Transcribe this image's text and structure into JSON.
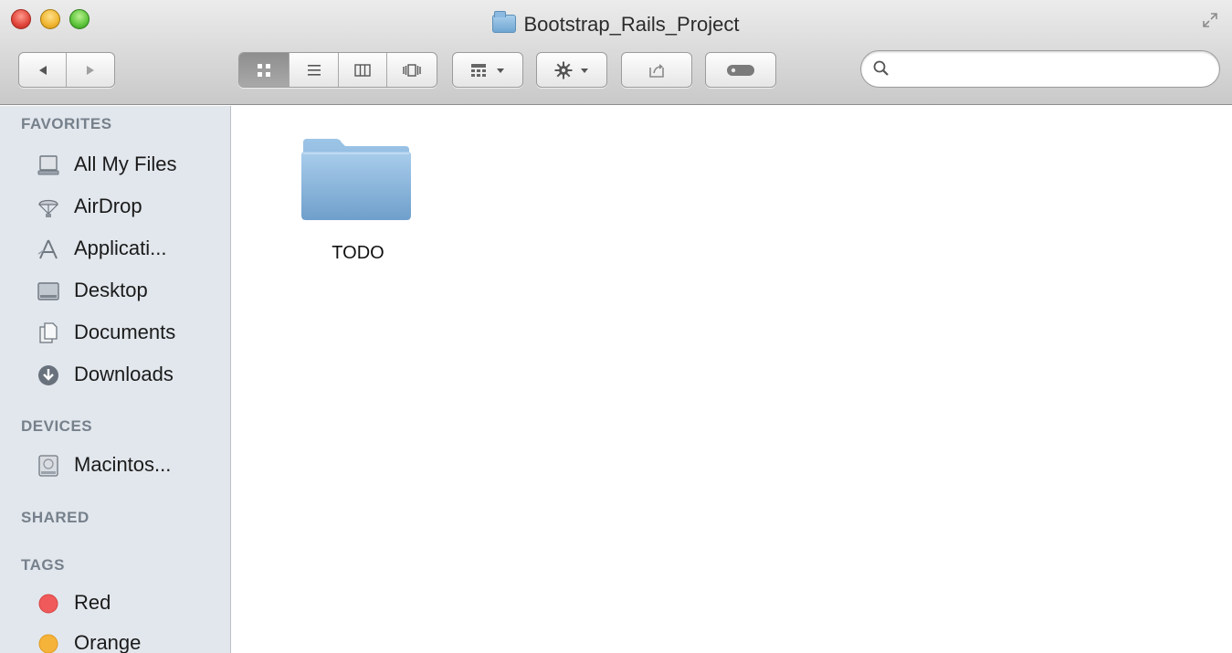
{
  "window": {
    "title": "Bootstrap_Rails_Project"
  },
  "toolbar": {
    "back_icon": "triangle-left",
    "forward_icon": "triangle-right",
    "view_modes": [
      "icon-view",
      "list-view",
      "column-view",
      "cover-flow-view"
    ],
    "active_view": "icon-view",
    "arrange_icon": "grid-arrange",
    "action_icon": "gear",
    "share_icon": "share",
    "tags_icon": "tag-pill"
  },
  "search": {
    "placeholder": "",
    "value": ""
  },
  "sidebar": {
    "favorites_header": "FAVORITES",
    "favorites": [
      {
        "label": "All My Files",
        "icon": "all-files"
      },
      {
        "label": "AirDrop",
        "icon": "airdrop"
      },
      {
        "label": "Applicati...",
        "icon": "applications"
      },
      {
        "label": "Desktop",
        "icon": "desktop"
      },
      {
        "label": "Documents",
        "icon": "documents"
      },
      {
        "label": "Downloads",
        "icon": "downloads"
      }
    ],
    "devices_header": "DEVICES",
    "devices": [
      {
        "label": "Macintos...",
        "icon": "hard-drive"
      }
    ],
    "shared_header": "SHARED",
    "tags_header": "TAGS",
    "tags": [
      {
        "label": "Red",
        "color": "#f05a5a"
      },
      {
        "label": "Orange",
        "color": "#f6b33a"
      }
    ]
  },
  "content": {
    "items": [
      {
        "name": "TODO",
        "kind": "folder",
        "color": "#8fbbe0"
      }
    ]
  }
}
